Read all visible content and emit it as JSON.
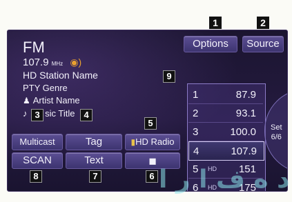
{
  "callouts": {
    "c1": "1",
    "c2": "2",
    "c3": "3",
    "c4": "4",
    "c5": "5",
    "c6": "6",
    "c7": "7",
    "c8": "8",
    "c9": "9"
  },
  "band": "FM",
  "frequency": "107.9",
  "frequency_unit": "MHz",
  "station_name": "HD Station Name",
  "genre": "PTY Genre",
  "artist": "Artist Name",
  "song_title_prefix": "♪",
  "song_title_part": "sic Title",
  "buttons": {
    "options": "Options",
    "source": "Source",
    "multicast": "Multicast",
    "tag": "Tag",
    "hd_radio": "HD Radio",
    "scan": "SCAN",
    "text": "Text"
  },
  "presets": [
    {
      "num": "1",
      "freq": "87.9"
    },
    {
      "num": "2",
      "freq": "93.1"
    },
    {
      "num": "3",
      "freq": "100.0"
    },
    {
      "num": "4",
      "freq": "107.9"
    },
    {
      "num": "5",
      "hd": "HD",
      "freq": "151"
    },
    {
      "num": "6",
      "hd": "HD",
      "freq": "175"
    }
  ],
  "set_label": "Set",
  "set_page": "6/6",
  "colors": {
    "accent": "#8d7cc9",
    "background": "#1b1530",
    "tag": "#111111",
    "hd_icon": "#e8c24a"
  }
}
